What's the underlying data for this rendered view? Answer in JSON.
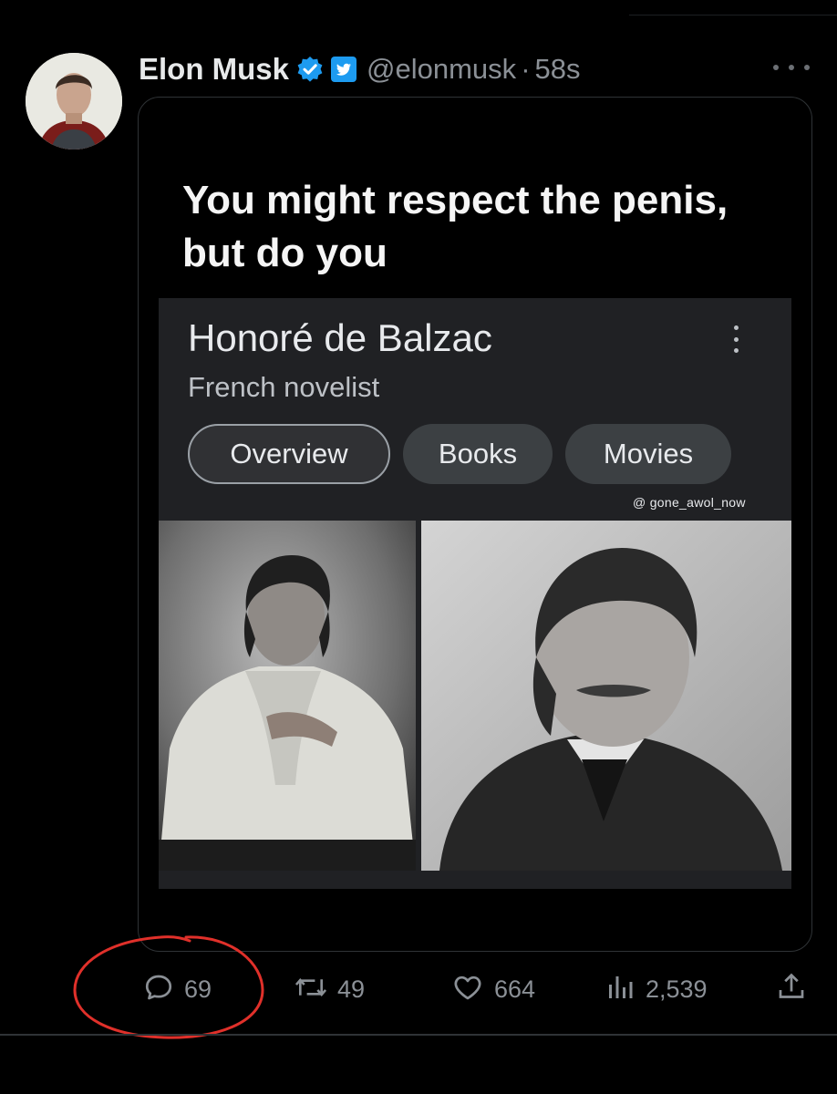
{
  "tweet": {
    "author_name": "Elon Musk",
    "handle": "@elonmusk",
    "separator": "·",
    "time": "58s",
    "icons": {
      "avatar": "avatar-photo",
      "verified": "verified-badge-icon",
      "twitter_badge": "twitter-bird-icon",
      "more": "more-options-icon"
    },
    "colors": {
      "verified": "#1d9bf0",
      "background": "#000000",
      "muted": "#8b9096"
    }
  },
  "media": {
    "caption_line1": "You might respect the penis,",
    "caption_line2": "but do you",
    "knowledge_panel": {
      "title": "Honoré de Balzac",
      "subtitle": "French novelist",
      "tabs": [
        {
          "label": "Overview",
          "selected": true
        },
        {
          "label": "Books",
          "selected": false
        },
        {
          "label": "Movies",
          "selected": false
        }
      ],
      "watermark": "@ gone_awol_now"
    }
  },
  "actions": {
    "replies": "69",
    "retweets": "49",
    "likes": "664",
    "views": "2,539"
  },
  "annotation": {
    "color": "#e0302a",
    "shape": "hand-drawn circle around reply count"
  }
}
